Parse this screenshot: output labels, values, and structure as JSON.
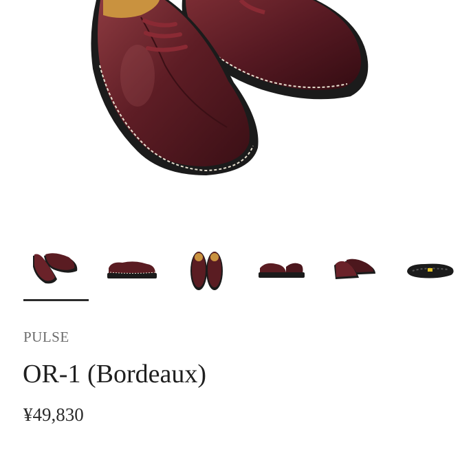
{
  "product": {
    "brand": "PULSE",
    "name": "OR-1 (Bordeaux)",
    "price": "¥49,830"
  },
  "gallery": {
    "thumbnails": [
      {
        "view": "pair-angled",
        "selected": true
      },
      {
        "view": "side-profile",
        "selected": false
      },
      {
        "view": "top-front",
        "selected": false
      },
      {
        "view": "pair-side",
        "selected": false
      },
      {
        "view": "pair-rear-angle",
        "selected": false
      },
      {
        "view": "outsole",
        "selected": false
      }
    ]
  },
  "colors": {
    "leather": "#5a1c22",
    "leather_highlight": "#8c3a40",
    "sole": "#1b1b1b",
    "lining": "#c9923f",
    "lace": "#8a2a34",
    "outsole_accent": "#e3c228"
  }
}
